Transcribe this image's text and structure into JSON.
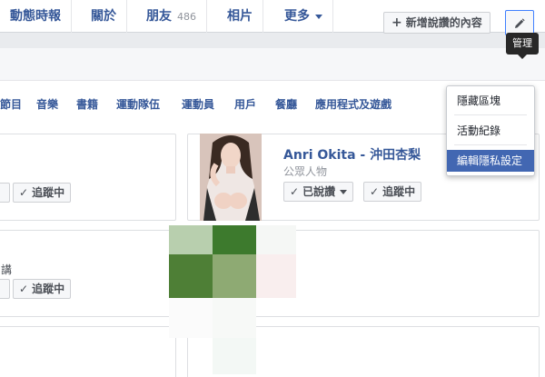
{
  "tabs": [
    {
      "label": "動態時報"
    },
    {
      "label": "關於"
    },
    {
      "label": "朋友",
      "count": "486"
    },
    {
      "label": "相片"
    },
    {
      "label": "更多"
    }
  ],
  "toolbar": {
    "add_label": "新增說讚的內容",
    "manage_tooltip": "管理",
    "manage_icon": "pencil-icon"
  },
  "categories": [
    "節目",
    "音樂",
    "書籍",
    "運動隊伍",
    "運動員",
    "用戶",
    "餐廳",
    "應用程式及遊戲"
  ],
  "menu": {
    "items": [
      {
        "label": "隱藏區塊"
      },
      {
        "label": "活動紀錄"
      },
      {
        "label": "編輯隱私設定"
      }
    ]
  },
  "cards": {
    "left_top": {
      "follow_label": "追蹤中"
    },
    "left_mid": {
      "fragment": "講",
      "follow_label": "追蹤中"
    },
    "featured": {
      "name": "Anri Okita - 沖田杏梨",
      "category": "公眾人物",
      "liked_label": "已說讚",
      "follow_label": "追蹤中"
    }
  },
  "colors": {
    "link": "#365899",
    "menu_active": "#4267b2",
    "focus_border": "#4080ff",
    "page_bg": "#e9ebee"
  }
}
